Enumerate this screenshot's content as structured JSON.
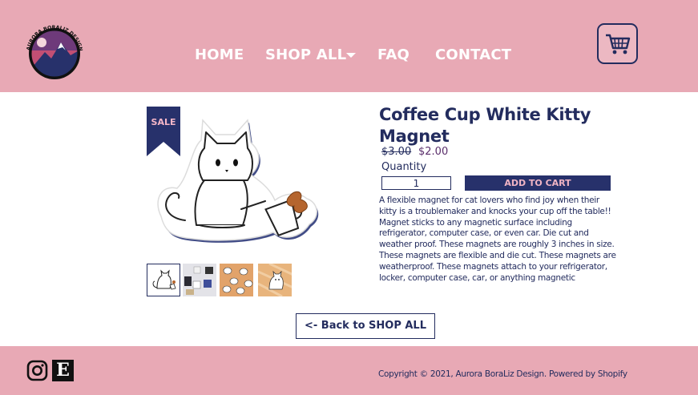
{
  "nav": {
    "home": "HOME",
    "shop_all": "SHOP ALL",
    "faq": "FAQ",
    "contact": "CONTACT"
  },
  "logo": {
    "text": "AURORA BORALIZ DESIGN"
  },
  "product": {
    "badge": "SALE",
    "title": "Coffee Cup White Kitty Magnet",
    "price_old": "$3.00",
    "price_new": "$2.00",
    "quantity_label": "Quantity",
    "quantity_value": "1",
    "add_to_cart": "ADD TO CART",
    "description": "A flexible magnet for cat lovers who find joy when their kitty is a troublemaker and knocks your cup off the table!! Magnet sticks to any magnetic surface including refrigerator, computer case, or even car. Die cut and weather proof. These magnets are roughly 3 inches in size. These magnets are flexible and die cut. These magnets are weatherproof. These magnets attach to your refrigerator, locker, computer case, car, or anything magnetic"
  },
  "back_link": "<-  Back to SHOP ALL",
  "footer": {
    "copyright": "Copyright © 2021, Aurora BoraLiz Design. Powered by Shopify",
    "etsy_letter": "E"
  },
  "colors": {
    "header_bg": "#e8a9b5",
    "navy": "#232c5e",
    "button_bg": "#27316b",
    "button_text": "#f0b4c4"
  },
  "icons": [
    "cart-icon",
    "instagram-icon",
    "etsy-icon",
    "chevron-down-icon"
  ]
}
